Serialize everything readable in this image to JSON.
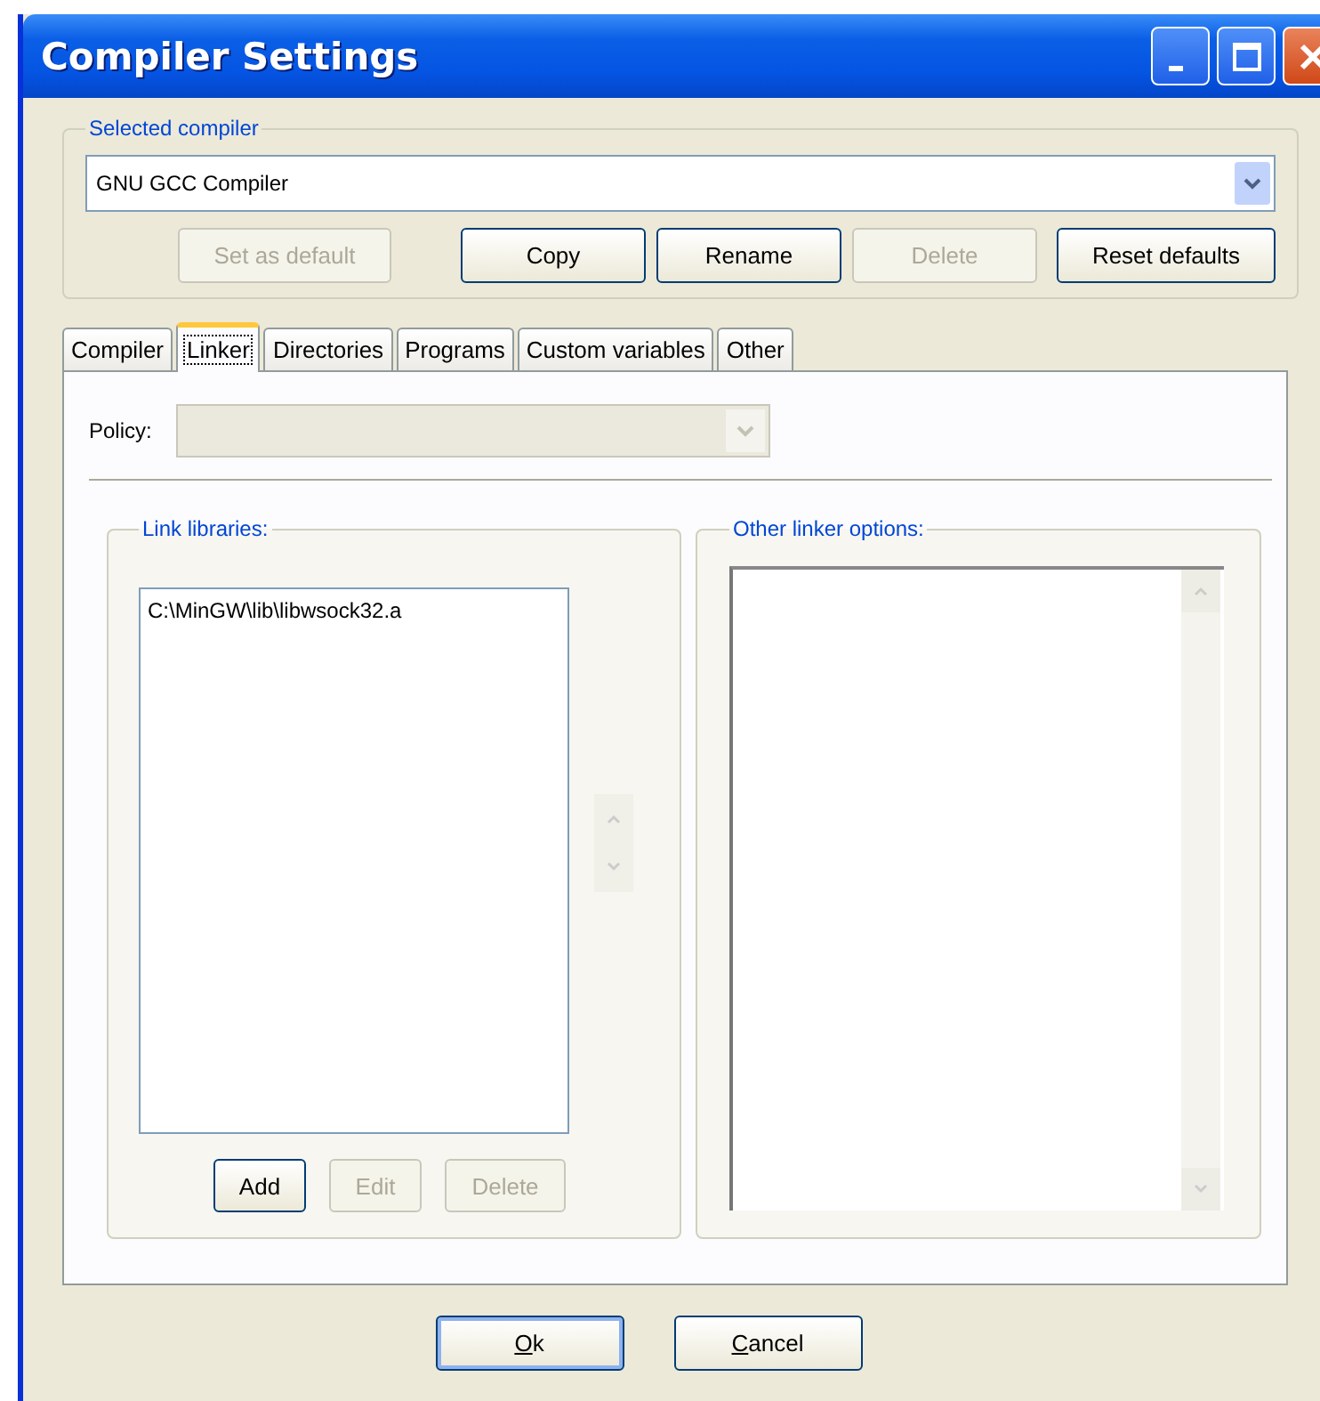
{
  "window": {
    "title": "Compiler Settings"
  },
  "selected_compiler": {
    "label": "Selected compiler",
    "value": "GNU GCC Compiler",
    "buttons": [
      {
        "label": "Set as default",
        "disabled": true
      },
      {
        "label": "Copy",
        "disabled": false
      },
      {
        "label": "Rename",
        "disabled": false
      },
      {
        "label": "Delete",
        "disabled": true
      },
      {
        "label": "Reset defaults",
        "disabled": false
      }
    ]
  },
  "tabs": [
    {
      "label": "Compiler",
      "selected": false
    },
    {
      "label": "Linker",
      "selected": true
    },
    {
      "label": "Directories",
      "selected": false
    },
    {
      "label": "Programs",
      "selected": false
    },
    {
      "label": "Custom variables",
      "selected": false
    },
    {
      "label": "Other",
      "selected": false
    }
  ],
  "policy": {
    "label": "Policy:",
    "disabled": true
  },
  "link_libraries": {
    "label": "Link libraries:",
    "items": [
      "C:\\MinGW\\lib\\libwsock32.a"
    ],
    "buttons": [
      {
        "label": "Add",
        "disabled": false
      },
      {
        "label": "Edit",
        "disabled": true
      },
      {
        "label": "Delete",
        "disabled": true
      }
    ]
  },
  "other_linker_options": {
    "label": "Other linker options:"
  },
  "dialog_buttons": [
    {
      "label": "Ok",
      "default": true,
      "underline_first": true
    },
    {
      "label": "Cancel",
      "default": false,
      "underline_first": true
    }
  ]
}
